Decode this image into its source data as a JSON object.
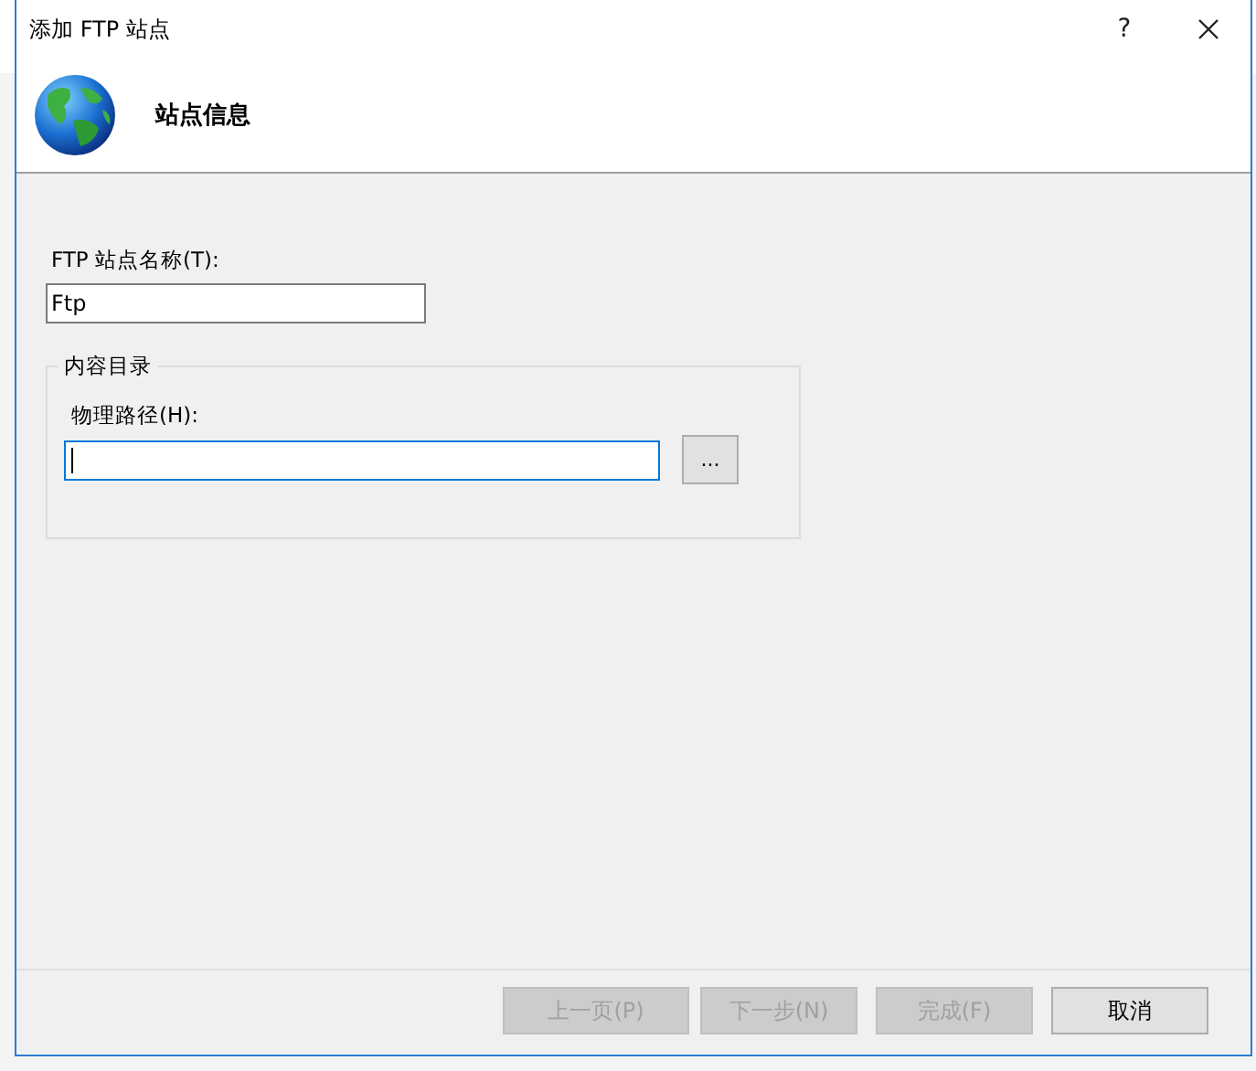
{
  "window": {
    "title": "添加 FTP 站点",
    "help": "?"
  },
  "header": {
    "title": "站点信息"
  },
  "site_name": {
    "label": "FTP 站点名称(T):",
    "value": "Ftp"
  },
  "content_directory": {
    "title": "内容目录",
    "path_label": "物理路径(H):",
    "path_focused": true,
    "browse": "..."
  },
  "buttons": [
    {
      "label": "上一页(P)",
      "disabled": true
    },
    {
      "label": "下一步(N)",
      "disabled": true
    },
    {
      "label": "完成(F)",
      "disabled": true
    },
    {
      "label": "取消",
      "disabled": false
    }
  ]
}
